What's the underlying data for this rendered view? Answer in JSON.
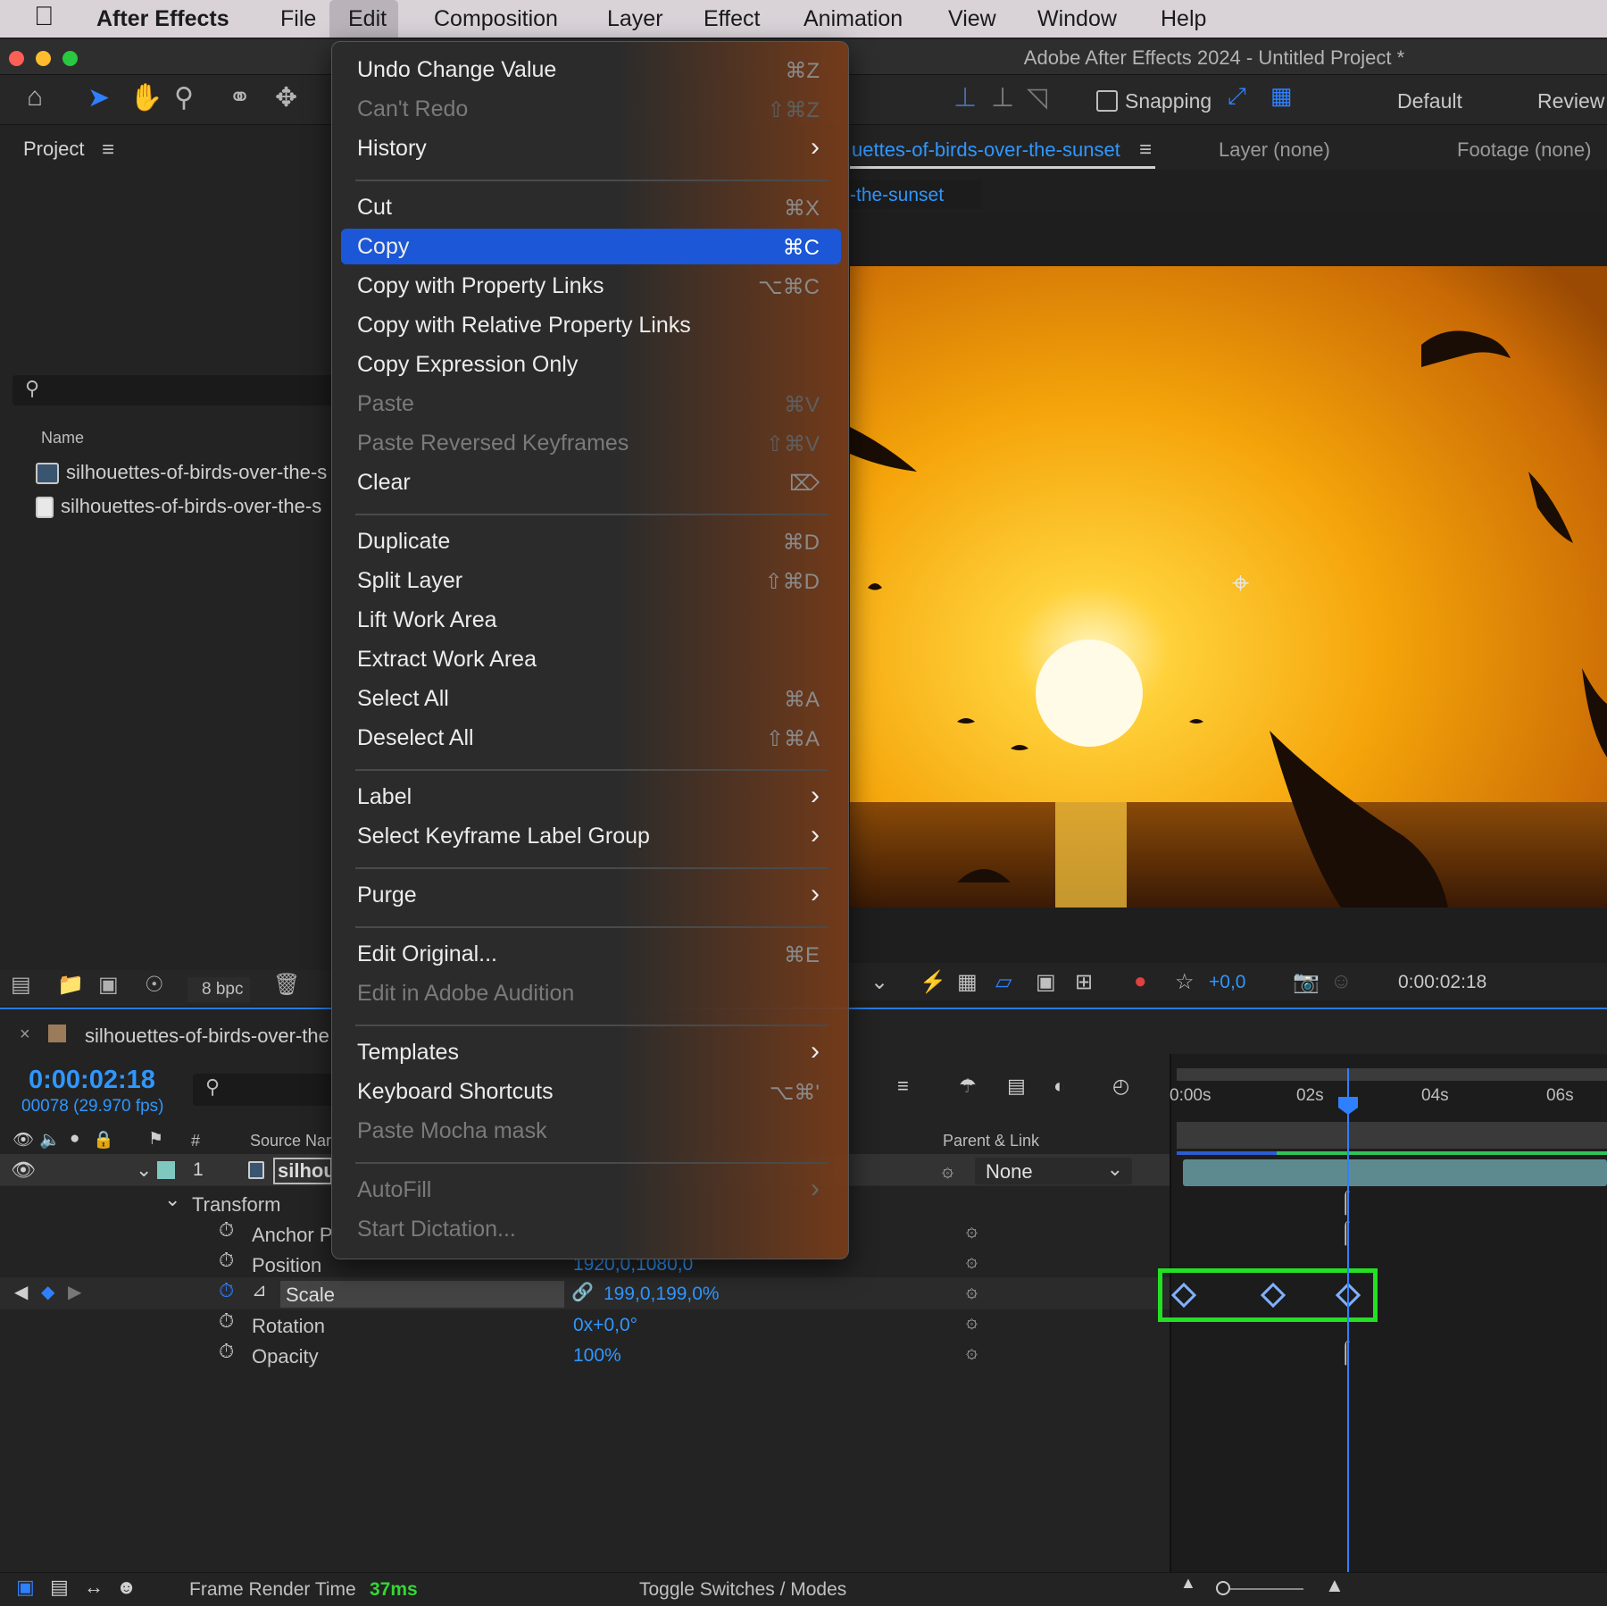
{
  "menubar": {
    "app": "After Effects",
    "items": [
      "File",
      "Edit",
      "Composition",
      "Layer",
      "Effect",
      "Animation",
      "View",
      "Window",
      "Help"
    ]
  },
  "window_title": "Adobe After Effects 2024 - Untitled Project *",
  "toolbar": {
    "snapping": "Snapping",
    "workspace_default": "Default",
    "workspace_review": "Review"
  },
  "project": {
    "title": "Project",
    "name_col": "Name",
    "items": [
      "silhouettes-of-birds-over-the-s",
      "silhouettes-of-birds-over-the-s"
    ],
    "bpc": "8 bpc"
  },
  "composition": {
    "tab_active": "uettes-of-birds-over-the-sunset",
    "layer_tab": "Layer",
    "layer_val": "(none)",
    "footage_tab": "Footage",
    "footage_val": "(none)",
    "sub_tab": "-the-sunset",
    "exposure": "+0,0",
    "timecode": "0:00:02:18"
  },
  "edit_menu": {
    "items": [
      {
        "label": "Undo Change Value",
        "shortcut": "⌘Z",
        "disabled": false
      },
      {
        "label": "Can't Redo",
        "shortcut": "⇧⌘Z",
        "disabled": true
      },
      {
        "label": "History",
        "shortcut": "",
        "disabled": false,
        "submenu": true
      },
      {
        "sep": true
      },
      {
        "label": "Cut",
        "shortcut": "⌘X",
        "disabled": false
      },
      {
        "label": "Copy",
        "shortcut": "⌘C",
        "disabled": false,
        "highlighted": true
      },
      {
        "label": "Copy with Property Links",
        "shortcut": "⌥⌘C",
        "disabled": false
      },
      {
        "label": "Copy with Relative Property Links",
        "shortcut": "",
        "disabled": false
      },
      {
        "label": "Copy Expression Only",
        "shortcut": "",
        "disabled": false
      },
      {
        "label": "Paste",
        "shortcut": "⌘V",
        "disabled": true
      },
      {
        "label": "Paste Reversed Keyframes",
        "shortcut": "⇧⌘V",
        "disabled": true
      },
      {
        "label": "Clear",
        "shortcut": "⌦",
        "disabled": false
      },
      {
        "sep": true
      },
      {
        "label": "Duplicate",
        "shortcut": "⌘D",
        "disabled": false
      },
      {
        "label": "Split Layer",
        "shortcut": "⇧⌘D",
        "disabled": false
      },
      {
        "label": "Lift Work Area",
        "shortcut": "",
        "disabled": false
      },
      {
        "label": "Extract Work Area",
        "shortcut": "",
        "disabled": false
      },
      {
        "label": "Select All",
        "shortcut": "⌘A",
        "disabled": false
      },
      {
        "label": "Deselect All",
        "shortcut": "⇧⌘A",
        "disabled": false
      },
      {
        "sep": true
      },
      {
        "label": "Label",
        "shortcut": "",
        "disabled": false,
        "submenu": true
      },
      {
        "label": "Select Keyframe Label Group",
        "shortcut": "",
        "disabled": false,
        "submenu": true
      },
      {
        "sep": true
      },
      {
        "label": "Purge",
        "shortcut": "",
        "disabled": false,
        "submenu": true
      },
      {
        "sep": true
      },
      {
        "label": "Edit Original...",
        "shortcut": "⌘E",
        "disabled": false
      },
      {
        "label": "Edit in Adobe Audition",
        "shortcut": "",
        "disabled": true
      },
      {
        "sep": true
      },
      {
        "label": "Templates",
        "shortcut": "",
        "disabled": false,
        "submenu": true
      },
      {
        "label": "Keyboard Shortcuts",
        "shortcut": "⌥⌘'",
        "disabled": false
      },
      {
        "label": "Paste Mocha mask",
        "shortcut": "",
        "disabled": true
      },
      {
        "sep": true
      },
      {
        "label": "AutoFill",
        "shortcut": "",
        "disabled": true,
        "submenu": true
      },
      {
        "label": "Start Dictation...",
        "shortcut": "",
        "disabled": true
      }
    ]
  },
  "timeline": {
    "tab": "silhouettes-of-birds-over-the",
    "timecode": "0:00:02:18",
    "fps": "00078 (29.970 fps)",
    "col_hash": "#",
    "col_source": "Source Nar",
    "col_parent": "Parent & Link",
    "layer_index": "1",
    "layer_name": "silhou",
    "parent_value": "None",
    "transform": "Transform",
    "props": [
      {
        "name": "Anchor P",
        "value": ""
      },
      {
        "name": "Position",
        "value": "1920,0,1080,0"
      },
      {
        "name": "Scale",
        "value": "199,0,199,0%"
      },
      {
        "name": "Rotation",
        "value": "0x+0,0°"
      },
      {
        "name": "Opacity",
        "value": "100%"
      }
    ],
    "ruler": [
      "0:00s",
      "02s",
      "04s",
      "06s"
    ],
    "keyframe_count": 3,
    "frame_render_label": "Frame Render Time",
    "frame_render_value": "37ms",
    "toggle": "Toggle Switches / Modes"
  },
  "colors": {
    "accent": "#2f97ff",
    "menu_highlight": "#1b57d6",
    "keyframe_box": "#24e024"
  }
}
